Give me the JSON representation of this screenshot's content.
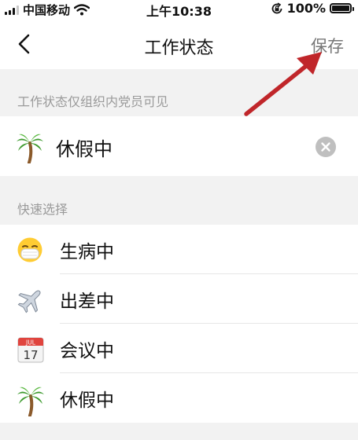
{
  "status_bar": {
    "carrier": "中国移动",
    "time": "上午10:38",
    "battery": "100%"
  },
  "navbar": {
    "title": "工作状态",
    "save_label": "保存",
    "back_icon": "chevron-left-icon"
  },
  "visibility_note": "工作状态仅组织内党员可见",
  "current_status": {
    "label": "休假中",
    "icon": "palm-tree-icon"
  },
  "quick_select_label": "快速选择",
  "quick_options": [
    {
      "label": "生病中",
      "icon": "mask-face-icon"
    },
    {
      "label": "出差中",
      "icon": "airplane-icon"
    },
    {
      "label": "会议中",
      "icon": "calendar-icon",
      "calendar_month": "JUL",
      "calendar_day": "17"
    },
    {
      "label": "休假中",
      "icon": "palm-tree-icon"
    }
  ],
  "colors": {
    "annotation_arrow": "#c0262a",
    "save_text": "#777777",
    "background": "#f2f2f2"
  }
}
